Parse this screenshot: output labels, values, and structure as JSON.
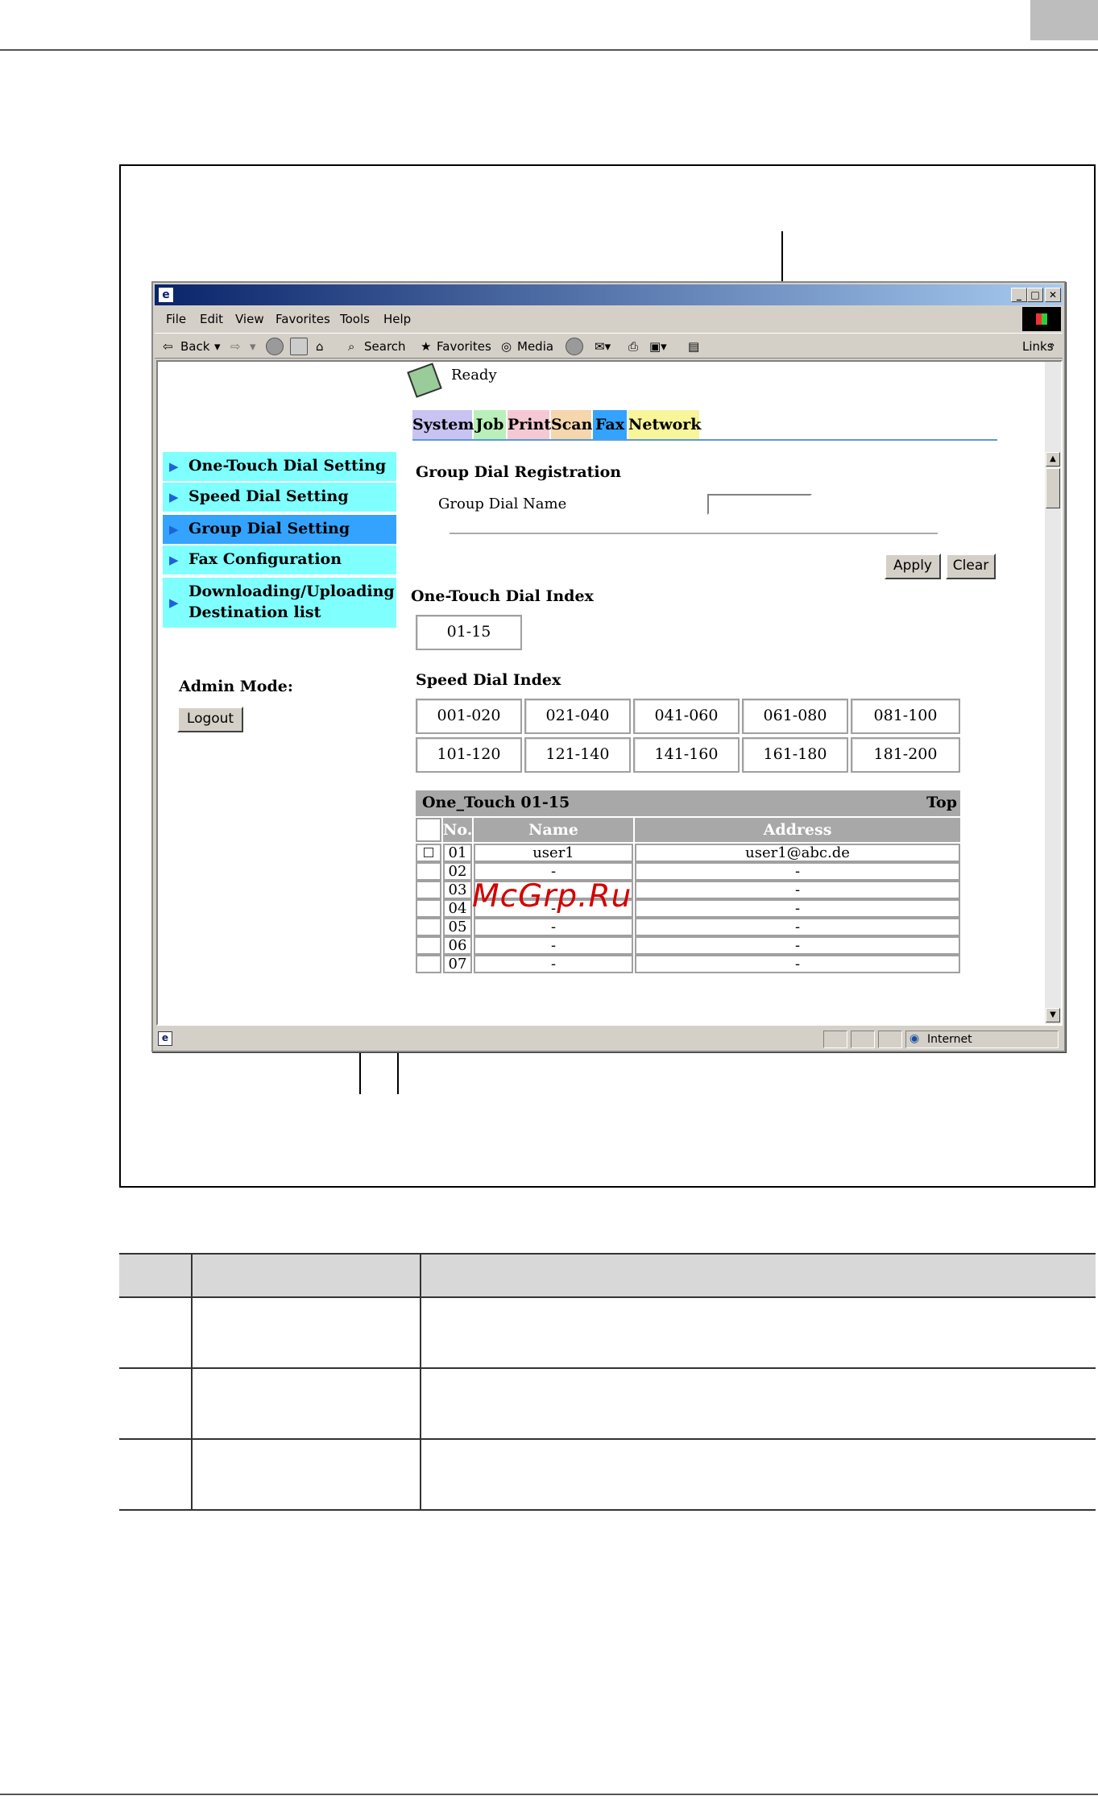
{
  "browser": {
    "menu": [
      "File",
      "Edit",
      "View",
      "Favorites",
      "Tools",
      "Help"
    ],
    "toolbar": {
      "back": "Back",
      "search": "Search",
      "favorites": "Favorites",
      "media": "Media",
      "links": "Links"
    },
    "status": {
      "zone": "Internet"
    }
  },
  "page": {
    "status_text": "Ready",
    "tabs": [
      {
        "label": "System",
        "color": "#c9c3f2"
      },
      {
        "label": "Job",
        "color": "#b9f0b9"
      },
      {
        "label": "Print",
        "color": "#f5c9d3"
      },
      {
        "label": "Scan",
        "color": "#f5d6ad"
      },
      {
        "label": "Fax",
        "color": "#33a3ff"
      },
      {
        "label": "Network",
        "color": "#f8f59a"
      }
    ],
    "nav": [
      {
        "label": "One-Touch Dial Setting"
      },
      {
        "label": "Speed Dial Setting"
      },
      {
        "label": "Group Dial Setting",
        "active": true
      },
      {
        "label": "Fax Configuration"
      },
      {
        "label": "Downloading/Uploading",
        "label2": "Destination list"
      }
    ],
    "admin_mode": "Admin Mode:",
    "logout": "Logout",
    "form_title": "Group Dial Registration",
    "group_dial_name_label": "Group Dial Name",
    "group_dial_name_value": "",
    "apply": "Apply",
    "clear": "Clear",
    "one_touch_index_title": "One-Touch Dial Index",
    "one_touch_index": [
      "01-15"
    ],
    "speed_index_title": "Speed Dial Index",
    "speed_index": [
      "001-020",
      "021-040",
      "041-060",
      "061-080",
      "081-100",
      "101-120",
      "121-140",
      "141-160",
      "161-180",
      "181-200"
    ],
    "list_title": "One_Touch 01-15",
    "list_top": "Top",
    "list_headers": {
      "no": "No.",
      "name": "Name",
      "address": "Address"
    },
    "rows": [
      {
        "no": "01",
        "name": "user1",
        "address": "user1@abc.de"
      },
      {
        "no": "02",
        "name": "-",
        "address": "-"
      },
      {
        "no": "03",
        "name": "-",
        "address": "-"
      },
      {
        "no": "04",
        "name": "-",
        "address": "-"
      },
      {
        "no": "05",
        "name": "-",
        "address": "-"
      },
      {
        "no": "06",
        "name": "-",
        "address": "-"
      },
      {
        "no": "07",
        "name": "-",
        "address": "-"
      }
    ]
  },
  "watermark": "McGrp.Ru"
}
